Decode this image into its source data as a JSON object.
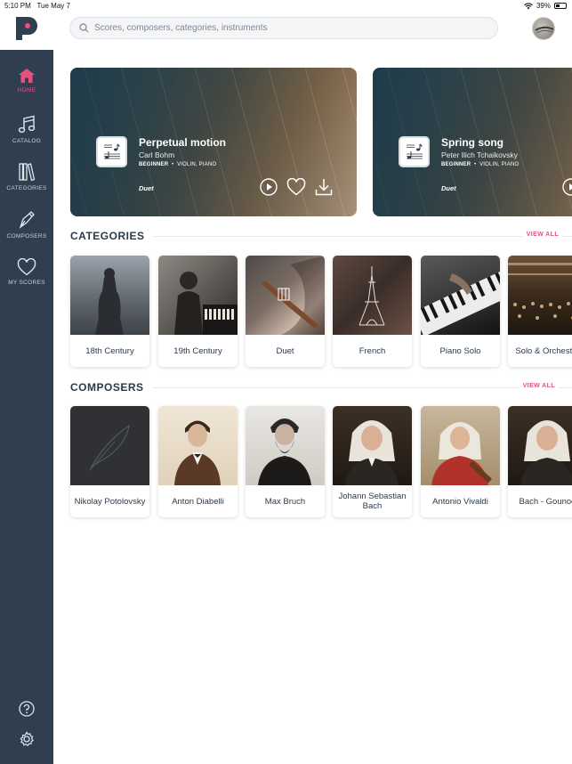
{
  "status_bar": {
    "time": "5:10 PM",
    "date": "Tue May 7",
    "battery": "39%"
  },
  "header": {
    "search_placeholder": "Scores, composers, categories, instruments"
  },
  "sidebar": {
    "items": [
      {
        "label": "HOME",
        "icon": "home-icon",
        "active": true
      },
      {
        "label": "CATALOG",
        "icon": "music-note-icon",
        "active": false
      },
      {
        "label": "CATEGORIES",
        "icon": "books-icon",
        "active": false
      },
      {
        "label": "COMPOSERS",
        "icon": "pen-nib-icon",
        "active": false
      },
      {
        "label": "MY SCORES",
        "icon": "heart-icon",
        "active": false
      }
    ],
    "bottom": [
      "help-icon",
      "settings-icon"
    ]
  },
  "featured": [
    {
      "title": "Perpetual motion",
      "composer": "Carl Bohm",
      "level": "BEGINNER",
      "instruments": "VIOLIN, PIANO",
      "tag": "Duet"
    },
    {
      "title": "Spring song",
      "composer": "Peter Ilich Tchaikovsky",
      "level": "BEGINNER",
      "instruments": "VIOLIN, PIANO",
      "tag": "Duet"
    }
  ],
  "categories": {
    "heading": "CATEGORIES",
    "view_all": "VIEW ALL",
    "items": [
      "18th Century",
      "19th Century",
      "Duet",
      "French",
      "Piano Solo",
      "Solo & Orchestra"
    ]
  },
  "composers": {
    "heading": "COMPOSERS",
    "view_all": "VIEW ALL",
    "items": [
      "Nikolay Potolovsky",
      "Anton Diabelli",
      "Max Bruch",
      "Johann Sebastian Bach",
      "Antonio Vivaldi",
      "Bach - Gounod"
    ]
  },
  "colors": {
    "accent": "#e5507e",
    "sidebar": "#2f3f4f",
    "heading": "#2b3a4a"
  }
}
